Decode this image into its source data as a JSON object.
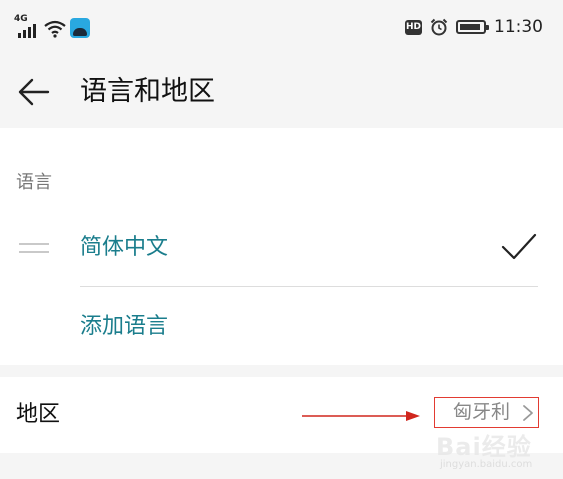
{
  "status_bar": {
    "network": "4G",
    "hd_badge": "HD",
    "time": "11:30",
    "icons": [
      "signal-icon",
      "wifi-icon",
      "app-notification-icon",
      "hd-icon",
      "alarm-icon",
      "battery-icon"
    ]
  },
  "app_bar": {
    "title": "语言和地区",
    "back_icon": "arrow-left-icon"
  },
  "language_section": {
    "label": "语言",
    "languages": [
      {
        "name": "简体中文",
        "selected": true
      }
    ],
    "add_language_label": "添加语言"
  },
  "region": {
    "label": "地区",
    "value": "匈牙利"
  },
  "watermark": {
    "text": "Bai经验",
    "subtext": "jingyan.baidu.com"
  },
  "colors": {
    "accent": "#1a7d8c",
    "background": "#f5f5f5",
    "card": "#ffffff",
    "annotation": "#e23b32"
  }
}
